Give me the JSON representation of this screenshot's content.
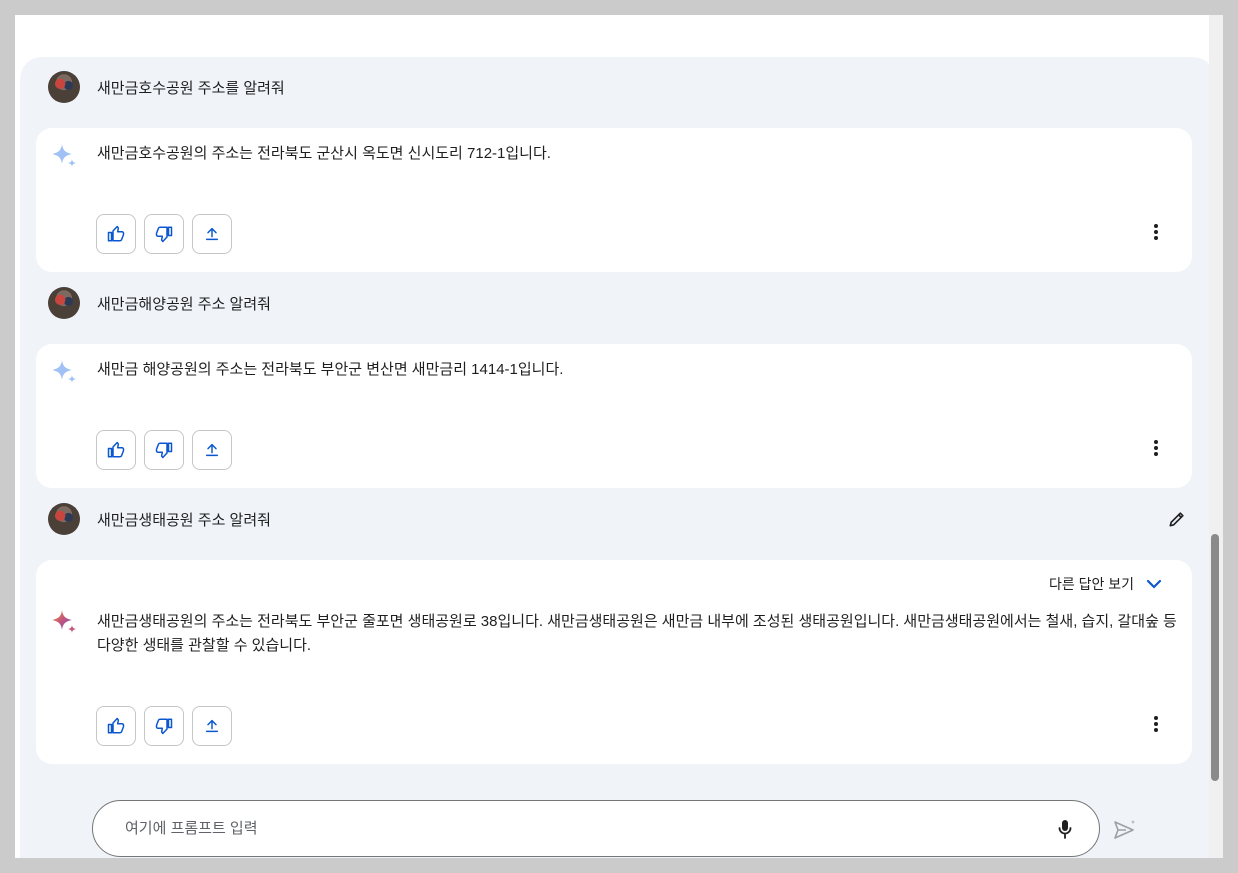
{
  "conversation": [
    {
      "query": "새만금호수공원 주소를 알려줘",
      "answer": "새만금호수공원의 주소는 전라북도 군산시 옥도면 신시도리 712-1입니다."
    },
    {
      "query": "새만금해양공원 주소 알려줘",
      "answer": "새만금 해양공원의 주소는 전라북도 부안군 변산면 새만금리 1414-1입니다."
    },
    {
      "query": "새만금생태공원 주소 알려줘",
      "other_drafts_label": "다른 답안 보기",
      "answer": "새만금생태공원의 주소는 전라북도 부안군 줄포면 생태공원로 38입니다. 새만금생태공원은 새만금 내부에 조성된 생태공원입니다. 새만금생태공원에서는 철새, 습지, 갈대숲 등 다양한 생태를 관찰할 수 있습니다."
    }
  ],
  "prompt": {
    "placeholder": "여기에 프롬프트 입력",
    "value": ""
  },
  "icons": {
    "thumbs_up": "thumbs-up-icon",
    "thumbs_down": "thumbs-down-icon",
    "share": "share-icon",
    "more": "more-vert-icon",
    "edit": "pencil-icon",
    "mic": "mic-icon",
    "send": "send-icon",
    "spark": "gemini-spark-icon"
  },
  "colors": {
    "accent": "#0b57d0",
    "chat_bg": "#f0f4f9",
    "card_bg": "#ffffff"
  }
}
